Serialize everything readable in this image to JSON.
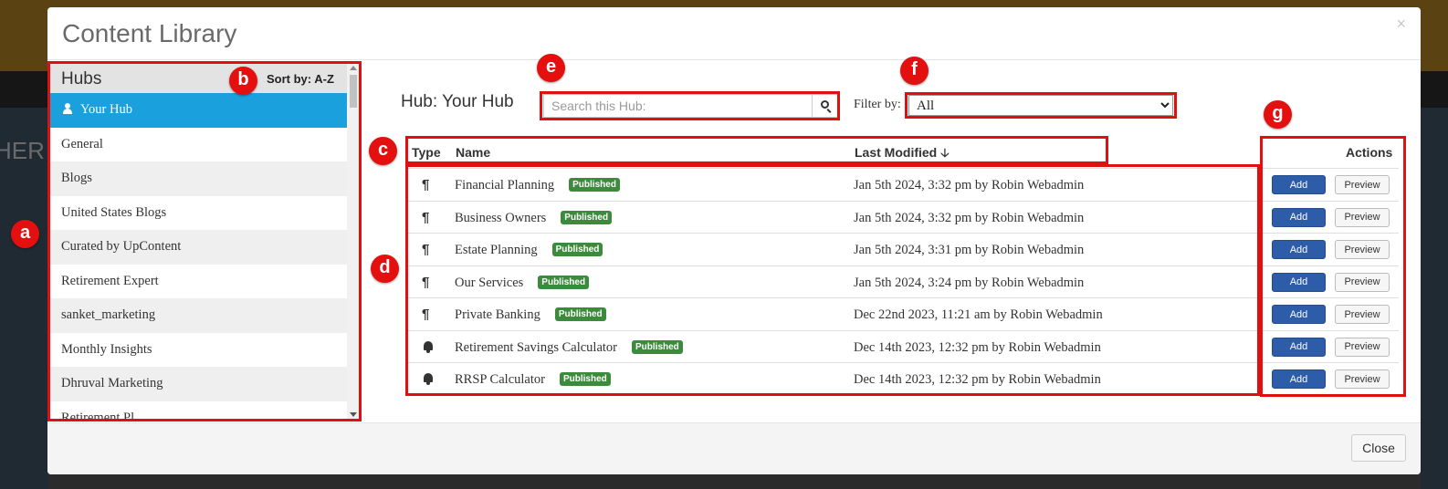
{
  "background": {
    "hero_text": "HER"
  },
  "modal": {
    "title": "Content Library",
    "close_symbol": "×",
    "close_button": "Close"
  },
  "hubs": {
    "title": "Hubs",
    "sort_label": "Sort by: A-Z",
    "items": [
      {
        "label": "Your Hub",
        "active": true
      },
      {
        "label": "General"
      },
      {
        "label": "Blogs"
      },
      {
        "label": "United States Blogs"
      },
      {
        "label": "Curated by UpContent"
      },
      {
        "label": "Retirement Expert"
      },
      {
        "label": "sanket_marketing"
      },
      {
        "label": "Monthly Insights"
      },
      {
        "label": "Dhruval Marketing"
      },
      {
        "label": "Retirement Pl..."
      }
    ]
  },
  "main": {
    "hub_title": "Hub: Your Hub",
    "search": {
      "placeholder": "Search this Hub:",
      "value": ""
    },
    "filter": {
      "label": "Filter by:",
      "selected": "All"
    },
    "columns": {
      "type": "Type",
      "name": "Name",
      "modified": "Last Modified",
      "actions": "Actions"
    },
    "rows": [
      {
        "type_icon": "paragraph-icon",
        "name": "Financial Planning",
        "status": "Published",
        "modified": "Jan 5th 2024, 3:32 pm by Robin Webadmin",
        "add": "Add",
        "preview": "Preview"
      },
      {
        "type_icon": "paragraph-icon",
        "name": "Business Owners",
        "status": "Published",
        "modified": "Jan 5th 2024, 3:32 pm by Robin Webadmin",
        "add": "Add",
        "preview": "Preview"
      },
      {
        "type_icon": "paragraph-icon",
        "name": "Estate Planning",
        "status": "Published",
        "modified": "Jan 5th 2024, 3:31 pm by Robin Webadmin",
        "add": "Add",
        "preview": "Preview"
      },
      {
        "type_icon": "paragraph-icon",
        "name": "Our Services",
        "status": "Published",
        "modified": "Jan 5th 2024, 3:24 pm by Robin Webadmin",
        "add": "Add",
        "preview": "Preview"
      },
      {
        "type_icon": "paragraph-icon",
        "name": "Private Banking",
        "status": "Published",
        "modified": "Dec 22nd 2023, 11:21 am by Robin Webadmin",
        "add": "Add",
        "preview": "Preview"
      },
      {
        "type_icon": "bell-icon",
        "name": "Retirement Savings Calculator",
        "status": "Published",
        "modified": "Dec 14th 2023, 12:32 pm by Robin Webadmin",
        "add": "Add",
        "preview": "Preview"
      },
      {
        "type_icon": "bell-icon",
        "name": "RRSP Calculator",
        "status": "Published",
        "modified": "Dec 14th 2023, 12:32 pm by Robin Webadmin",
        "add": "Add",
        "preview": "Preview"
      }
    ]
  },
  "annotations": {
    "a": "a",
    "b": "b",
    "c": "c",
    "d": "d",
    "e": "e",
    "f": "f",
    "g": "g"
  },
  "colors": {
    "accent": "#1aa0dc",
    "annotation_red": "#e01010",
    "published_green": "#3c8b3c",
    "add_blue": "#2d5ca8"
  }
}
